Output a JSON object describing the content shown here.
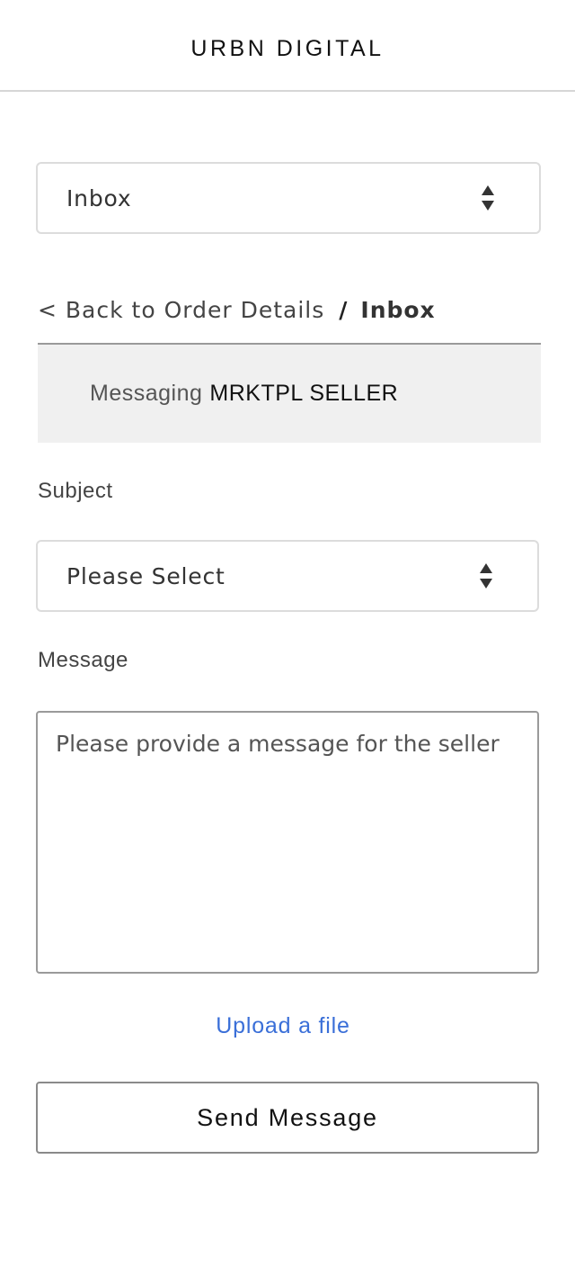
{
  "header": {
    "brand": "URBN DIGITAL"
  },
  "inbox_select": {
    "value": "Inbox",
    "icon": "select-arrows-icon"
  },
  "breadcrumb": {
    "back_label": "< Back to Order Details",
    "separator": "/",
    "current": "Inbox"
  },
  "messaging": {
    "prefix": "Messaging",
    "seller": "MRKTPL SELLER"
  },
  "subject": {
    "label": "Subject",
    "value": "Please Select",
    "icon": "select-arrows-icon"
  },
  "message": {
    "label": "Message",
    "placeholder": "Please provide a message for the seller",
    "value": ""
  },
  "upload": {
    "label": "Upload a file"
  },
  "send_button": {
    "label": "Send Message"
  },
  "colors": {
    "link": "#3a6fd8",
    "bar_background": "#f0f0f0"
  }
}
